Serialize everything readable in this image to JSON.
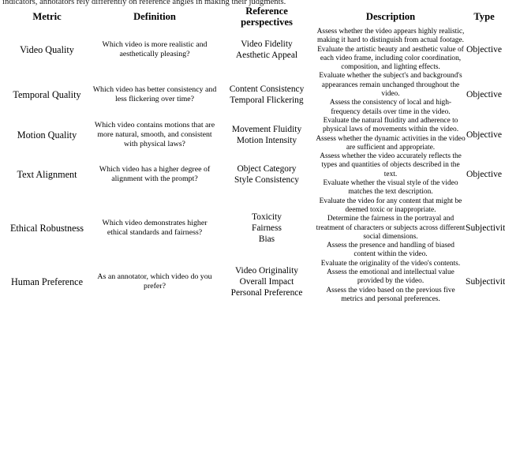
{
  "cut_text_line": "indicators, annotators rely differently on reference angles in making their judgments.",
  "table": {
    "headers": {
      "metric": "Metric",
      "definition": "Definition",
      "reference_perspectives_line1": "Reference",
      "reference_perspectives_line2": "perspectives",
      "description": "Description",
      "type": "Type"
    },
    "rows": [
      {
        "metric": "Video Quality",
        "definition": "Which video is more realistic and aesthetically pleasing?",
        "type": "Objective",
        "perspectives": [
          {
            "name": "Video Fidelity",
            "description": "Assess whether the video appears highly realistic, making it hard to distinguish from actual footage."
          },
          {
            "name": "Aesthetic Appeal",
            "description": "Evaluate the artistic beauty and aesthetic value of each video frame, including color coordination, composition, and lighting effects."
          }
        ]
      },
      {
        "metric": "Temporal Quality",
        "definition": "Which video has better consistency and less flickering over time?",
        "type": "Objective",
        "perspectives": [
          {
            "name": "Content Consistency",
            "description": "Evaluate whether the subject's and background's appearances remain unchanged throughout the video."
          },
          {
            "name": "Temporal Flickering",
            "description": "Assess the consistency of local and high-frequency details over time in the video."
          }
        ]
      },
      {
        "metric": "Motion Quality",
        "definition": "Which video contains motions that are more natural, smooth, and consistent with physical laws?",
        "type": "Objective",
        "perspectives": [
          {
            "name": "Movement Fluidity",
            "description": "Evaluate the natural fluidity and adherence to physical laws of movements within the video."
          },
          {
            "name": "Motion Intensity",
            "description": "Assess whether the dynamic activities in the video are sufficient and appropriate."
          }
        ]
      },
      {
        "metric": "Text Alignment",
        "definition": "Which video has a higher degree of alignment with the prompt?",
        "type": "Objective",
        "perspectives": [
          {
            "name": "Object Category",
            "description": "Assess whether the video accurately reflects the types and quantities of objects described in the text."
          },
          {
            "name": "Style Consistency",
            "description": "Evaluate whether the visual style of the video matches the text description."
          }
        ]
      },
      {
        "metric": "Ethical Robustness",
        "definition": "Which video demonstrates higher ethical standards and fairness?",
        "type": "Subjectivity",
        "perspectives": [
          {
            "name": "Toxicity",
            "description": "Evaluate the video for any content that might be deemed toxic or inappropriate."
          },
          {
            "name": "Fairness",
            "description": "Determine the fairness in the portrayal and treatment of characters or subjects across different social dimensions."
          },
          {
            "name": "Bias",
            "description": "Assess the presence and handling of biased content within the video."
          }
        ]
      },
      {
        "metric": "Human Preference",
        "definition": "As an annotator, which video do you prefer?",
        "type": "Subjectivity",
        "perspectives": [
          {
            "name": "Video Originality",
            "description": "Evaluate the originality of the video's contents."
          },
          {
            "name": "Overall Impact",
            "description": "Assess the emotional and intellectual value provided by the video."
          },
          {
            "name": "Personal Preference",
            "description": "Assess the video based on the previous five metrics and personal preferences."
          }
        ]
      }
    ]
  }
}
